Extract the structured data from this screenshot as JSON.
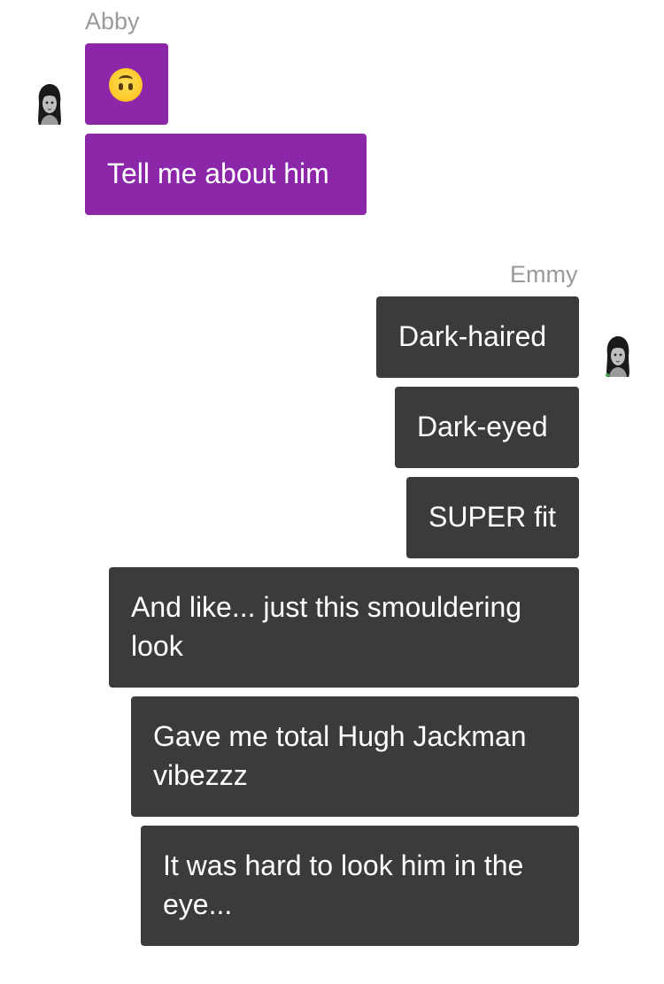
{
  "thread": [
    {
      "sender": "Abby",
      "direction": "incoming",
      "bubble_color": "#8d27aa",
      "avatar_icon": "female-avatar-icon",
      "messages": [
        {
          "type": "emoji",
          "emoji": "🙃",
          "icon": "upside-down-face-emoji-icon"
        },
        {
          "type": "text",
          "text": "Tell me about him"
        }
      ]
    },
    {
      "sender": "Emmy",
      "direction": "outgoing",
      "bubble_color": "#3b3b3b",
      "avatar_icon": "female-avatar-icon",
      "messages": [
        {
          "type": "text",
          "text": "Dark-haired"
        },
        {
          "type": "text",
          "text": "Dark-eyed"
        },
        {
          "type": "text",
          "text": "SUPER fit"
        },
        {
          "type": "text",
          "text": "And like... just this smouldering look"
        },
        {
          "type": "text",
          "text": "Gave me total Hugh Jackman vibezzz"
        },
        {
          "type": "text",
          "text": "It was hard to look him in the eye..."
        }
      ]
    }
  ]
}
